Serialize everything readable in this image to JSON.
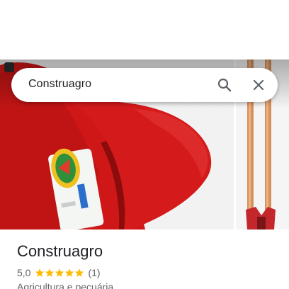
{
  "search": {
    "query": "Construagro"
  },
  "place": {
    "name": "Construagro",
    "rating": "5,0",
    "stars": 5,
    "reviews": "(1)",
    "category": "Agricultura e pecuária"
  },
  "icons": {
    "search": "search-icon",
    "close": "close-icon",
    "star": "star-icon"
  },
  "colors": {
    "star": "#fbbc04",
    "tool_red": "#d01818",
    "handle_wood": "#d9905a"
  }
}
